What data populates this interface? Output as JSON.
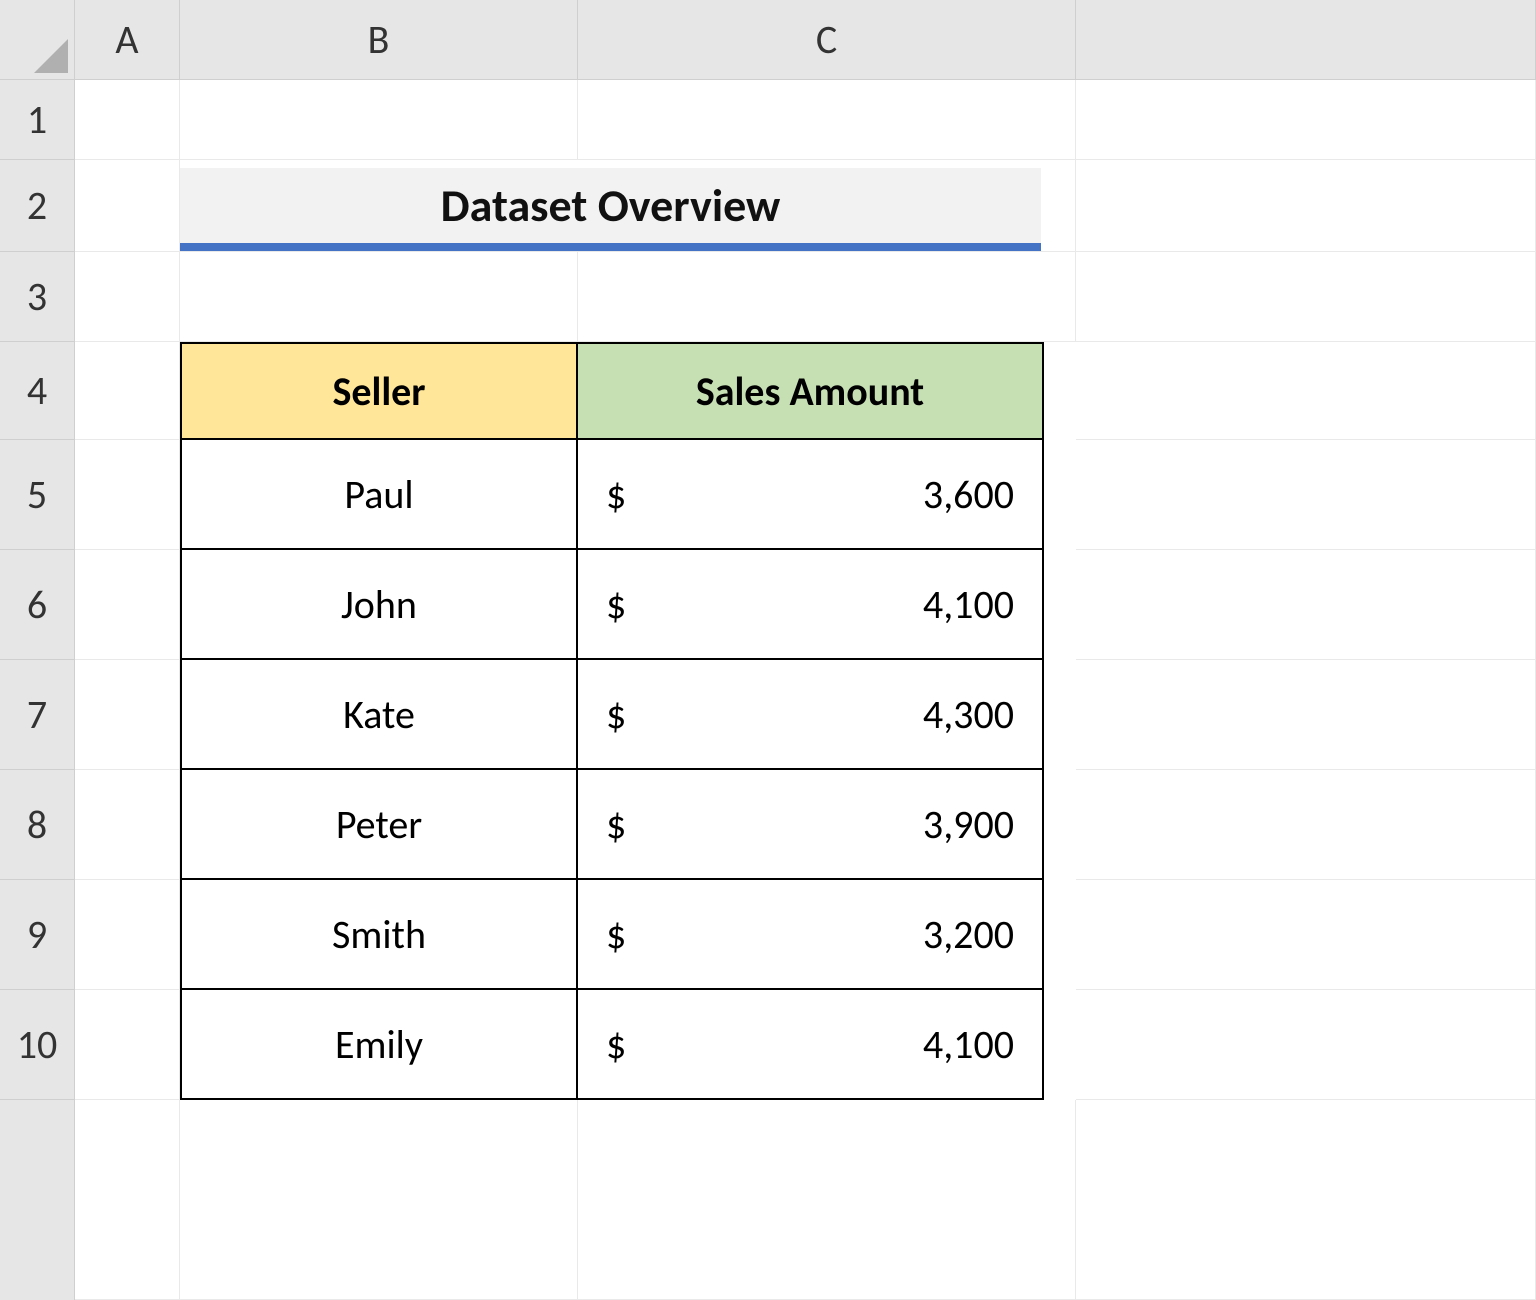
{
  "columns": [
    "A",
    "B",
    "C"
  ],
  "rows": [
    "1",
    "2",
    "3",
    "4",
    "5",
    "6",
    "7",
    "8",
    "9",
    "10"
  ],
  "title": "Dataset Overview",
  "table": {
    "headers": {
      "seller": "Seller",
      "amount": "Sales Amount"
    },
    "currency": "$",
    "rows": [
      {
        "seller": "Paul",
        "amount": "3,600"
      },
      {
        "seller": "John",
        "amount": "4,100"
      },
      {
        "seller": "Kate",
        "amount": "4,300"
      },
      {
        "seller": "Peter",
        "amount": "3,900"
      },
      {
        "seller": "Smith",
        "amount": "3,200"
      },
      {
        "seller": "Emily",
        "amount": "4,100"
      }
    ]
  },
  "chart_data": {
    "type": "table",
    "title": "Dataset Overview",
    "columns": [
      "Seller",
      "Sales Amount"
    ],
    "rows": [
      [
        "Paul",
        3600
      ],
      [
        "John",
        4100
      ],
      [
        "Kate",
        4300
      ],
      [
        "Peter",
        3900
      ],
      [
        "Smith",
        3200
      ],
      [
        "Emily",
        4100
      ]
    ]
  }
}
